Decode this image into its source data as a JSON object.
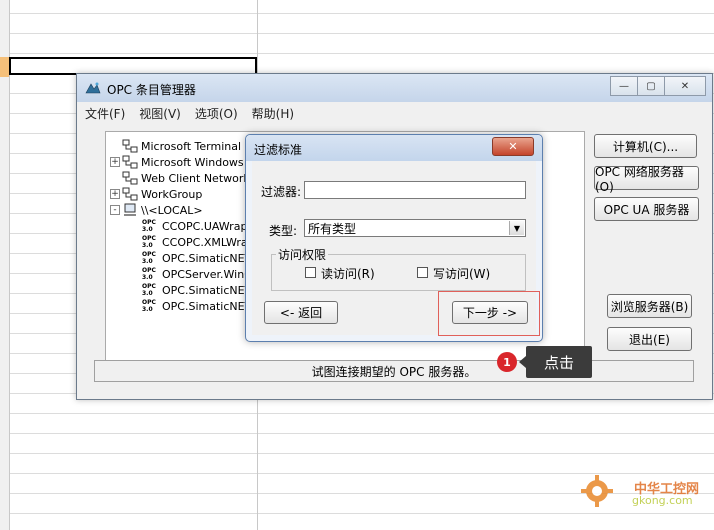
{
  "main_window": {
    "title": "OPC 条目管理器",
    "menu": [
      "文件(F)",
      "视图(V)",
      "选项(O)",
      "帮助(H)"
    ],
    "tree": [
      {
        "label": "Microsoft Terminal Se",
        "expander": "",
        "icon": "network-icon"
      },
      {
        "label": "Microsoft Windows N",
        "expander": "+",
        "icon": "network-icon"
      },
      {
        "label": "Web Client Network",
        "expander": "",
        "icon": "network-icon"
      },
      {
        "label": "WorkGroup",
        "expander": "+",
        "icon": "network-icon"
      },
      {
        "label": "\\\\<LOCAL>",
        "expander": "-",
        "icon": "computer-icon"
      },
      {
        "label": "CCOPC.UAWrap",
        "icon": "opc-server-icon"
      },
      {
        "label": "CCOPC.XMLWrap",
        "icon": "opc-server-icon"
      },
      {
        "label": "OPC.SimaticNET.",
        "icon": "opc-server-icon"
      },
      {
        "label": "OPCServer.WinC",
        "icon": "opc-server-icon"
      },
      {
        "label": "OPC.SimaticNET.",
        "icon": "opc-server-icon"
      },
      {
        "label": "OPC.SimaticNET.",
        "icon": "opc-server-icon"
      }
    ],
    "opc_icon_text": [
      "OPC",
      "3.0"
    ],
    "buttons": {
      "computer": "计算机(C)...",
      "opc_network_server": "OPC 网络服务器(O)",
      "opc_ua_server": "OPC UA 服务器",
      "browse_server": "浏览服务器(B)",
      "exit": "退出(E)"
    },
    "status_text": "试图连接期望的 OPC 服务器。"
  },
  "filter_dialog": {
    "title": "过滤标准",
    "filter_label": "过滤器:",
    "filter_value": "",
    "type_label": "类型:",
    "type_value": "所有类型",
    "access_group_label": "访问权限",
    "read_access_label": "读访问(R)",
    "write_access_label": "写访问(W)",
    "read_access_checked": false,
    "write_access_checked": false,
    "back_button": "<- 返回",
    "next_button": "下一步 ->"
  },
  "annotation": {
    "step_number": "1",
    "callout_text": "点击"
  },
  "watermark": {
    "line1": "中华工控网",
    "line2": "gkong.com"
  },
  "colors": {
    "callout_bg": "#3b3b3b",
    "badge_red": "#d9262b",
    "highlight_red": "#e0605a",
    "title_blue": "#c5d5ea"
  }
}
